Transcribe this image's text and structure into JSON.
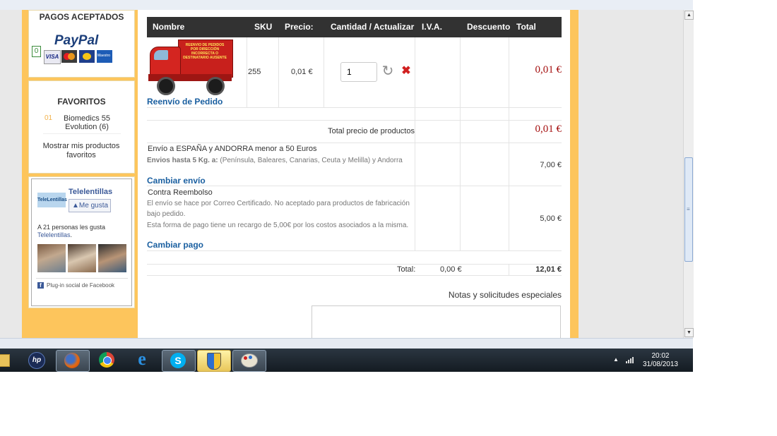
{
  "sidebar": {
    "payments_title": "PAGOS ACEPTADOS",
    "paypal_text": "PayPal",
    "paypal_badge": "0",
    "card_visa": "VISA",
    "card_maestro": "Maestro",
    "favorites_title": "FAVORITOS",
    "favorites": [
      {
        "num": "01",
        "name": "Biomedics 55 Evolution (6)"
      }
    ],
    "show_favorites": "Mostrar mis productos favoritos",
    "facebook": {
      "page_name": "Telelentillas",
      "logo_text": "TeleLentillas",
      "like_label": "Me gusta",
      "likes_text": "A 21 personas les gusta",
      "likes_link": "Telelentillas",
      "plugin_text": "Plug-in social de Facebook"
    }
  },
  "table": {
    "headers": [
      "Nombre",
      "SKU",
      "Precio:",
      "Cantidad / Actualizar",
      "I.V.A.",
      "Descuento",
      "Total"
    ],
    "product": {
      "truck_text": "REENVIO DE PEDIDOS POR DIRECCIÓN INCORRECTA O DESTINATARIO AUSENTE",
      "name": "Reenvío de Pedido",
      "sku": "255",
      "price": "0,01 €",
      "quantity": "1",
      "total": "0,01 €"
    },
    "subtotal_label": "Total precio de productos",
    "subtotal_value": "0,01 €",
    "shipping": {
      "title": "Envío a ESPAÑA y ANDORRA menor a 50 Euros",
      "detail_bold": "Envios hasta 5 Kg. a:",
      "detail_rest": "(Península, Baleares, Canarias, Ceuta y Melilla) y Andorra",
      "change_label": "Cambiar envío",
      "cost": "7,00 €"
    },
    "payment": {
      "title": "Contra Reembolso",
      "line1": "El envío se hace por Correo Certificado.  No aceptado para productos de fabricación",
      "line2": "bajo pedido.",
      "line3": "Esta forma de pago tiene un recargo de 5,00€ por los costos asociados a la misma.",
      "change_label": "Cambiar pago",
      "cost": "5,00 €"
    },
    "totals": {
      "label": "Total:",
      "iva": "0,00 €",
      "total": "12,01 €"
    },
    "notes_label": "Notas y solicitudes especiales"
  },
  "taskbar": {
    "time": "20:02",
    "date": "31/08/2013",
    "apps": [
      "explorer-icon",
      "hp-icon",
      "firefox-icon",
      "chrome-icon",
      "ie-icon",
      "skype-icon",
      "security-shield-icon",
      "paint-icon"
    ]
  }
}
